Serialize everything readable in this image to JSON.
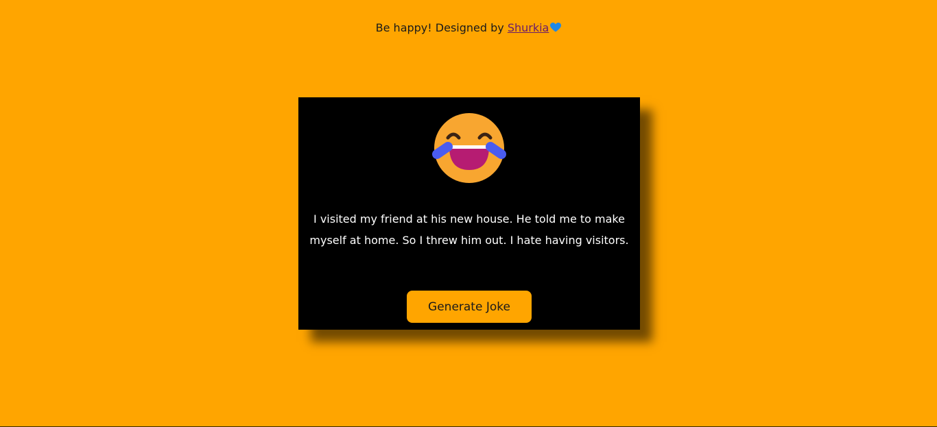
{
  "header": {
    "credit_prefix": "Be happy! Designed by",
    "author_link": "Shurkia",
    "heart_icon": "blue-heart-icon"
  },
  "card": {
    "emoji_icon": "face-with-tears-of-joy-icon",
    "joke_text": "I visited my friend at his new house. He told me to make myself at home. So I threw him out. I hate having visitors.",
    "button_label": "Generate Joke"
  },
  "colors": {
    "page_background": "#FFA500",
    "card_background": "#000000",
    "button_background": "#FFA500",
    "joke_text": "#FFFFFF",
    "link": "#6A1B6A",
    "heart": "#1E88E5"
  }
}
